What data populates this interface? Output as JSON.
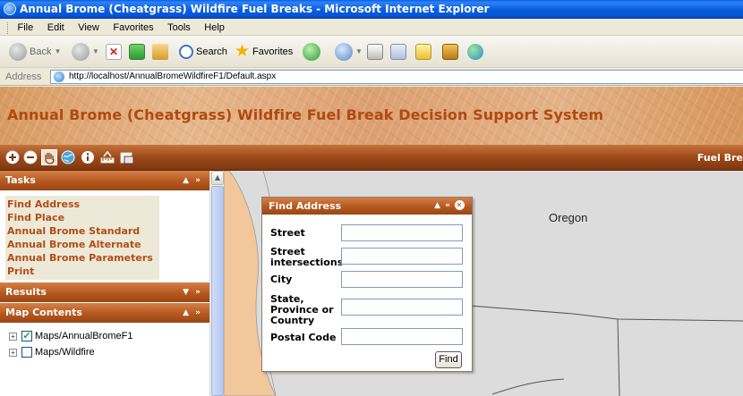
{
  "window": {
    "title": "Annual Brome (Cheatgrass) Wildfire Fuel Breaks - Microsoft Internet Explorer"
  },
  "menubar": {
    "items": [
      "File",
      "Edit",
      "View",
      "Favorites",
      "Tools",
      "Help"
    ]
  },
  "toolbar": {
    "back_label": "Back",
    "search_label": "Search",
    "favorites_label": "Favorites"
  },
  "addressbar": {
    "label": "Address",
    "url": "http://localhost/AnnualBromeWildfireF1/Default.aspx"
  },
  "page": {
    "title": "Annual Brome (Cheatgrass) Wildfire Fuel Break Decision Support System"
  },
  "map_toolbar": {
    "tools": [
      "zoom-in-icon",
      "zoom-out-icon",
      "pan-hand-icon",
      "full-extent-globe-icon",
      "identify-info-icon",
      "measure-icon",
      "print-icon"
    ],
    "right_label": "Fuel Bre"
  },
  "tasks": {
    "title": "Tasks",
    "controls": "▲ »",
    "items": [
      "Find Address",
      "Find Place",
      "Annual Brome Standard",
      "Annual Brome Alternate",
      "Annual Brome Parameters",
      "Print"
    ]
  },
  "results": {
    "title": "Results",
    "controls": "▼ »"
  },
  "map_contents": {
    "title": "Map Contents",
    "controls": "▲ »",
    "layers": [
      {
        "name": "Maps/AnnualBromeF1",
        "checked": true
      },
      {
        "name": "Maps/Wildfire",
        "checked": false
      }
    ]
  },
  "map": {
    "state_label": "Oregon"
  },
  "find_address": {
    "title": "Find Address",
    "controls": "▲ «",
    "fields": {
      "street": {
        "label": "Street",
        "value": ""
      },
      "intersections": {
        "label_line1": "Street",
        "label_line2": "intersections",
        "value": ""
      },
      "city": {
        "label": "City",
        "value": ""
      },
      "state": {
        "label_line1": "State,",
        "label_line2": "Province or",
        "label_line3": "Country",
        "value": ""
      },
      "postal": {
        "label": "Postal Code",
        "value": ""
      }
    },
    "button_label": "Find"
  },
  "colors": {
    "accent_orange": "#b5581f",
    "task_link": "#b24d16",
    "title_text": "#b04a10"
  }
}
